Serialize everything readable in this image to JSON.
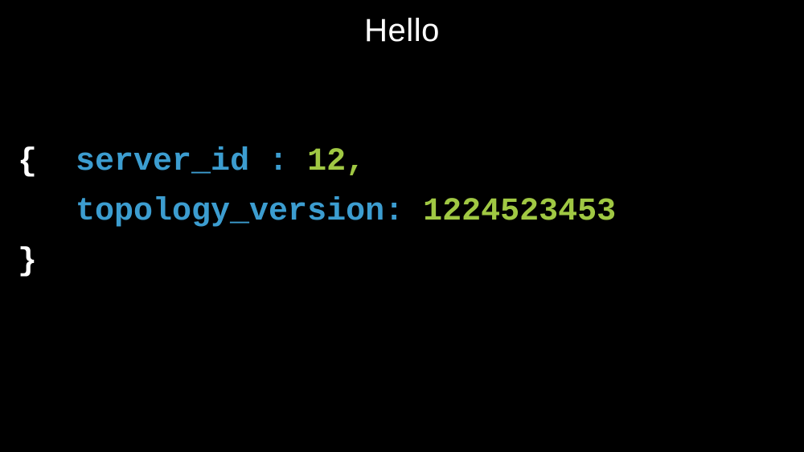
{
  "title": "Hello",
  "code": {
    "brace_open": "{",
    "brace_close": "}",
    "line1": {
      "key": "server_id",
      "sep": " : ",
      "value": "12",
      "comma": ","
    },
    "line2": {
      "key": "topology_version",
      "sep": ": ",
      "value": "1224523453"
    }
  }
}
